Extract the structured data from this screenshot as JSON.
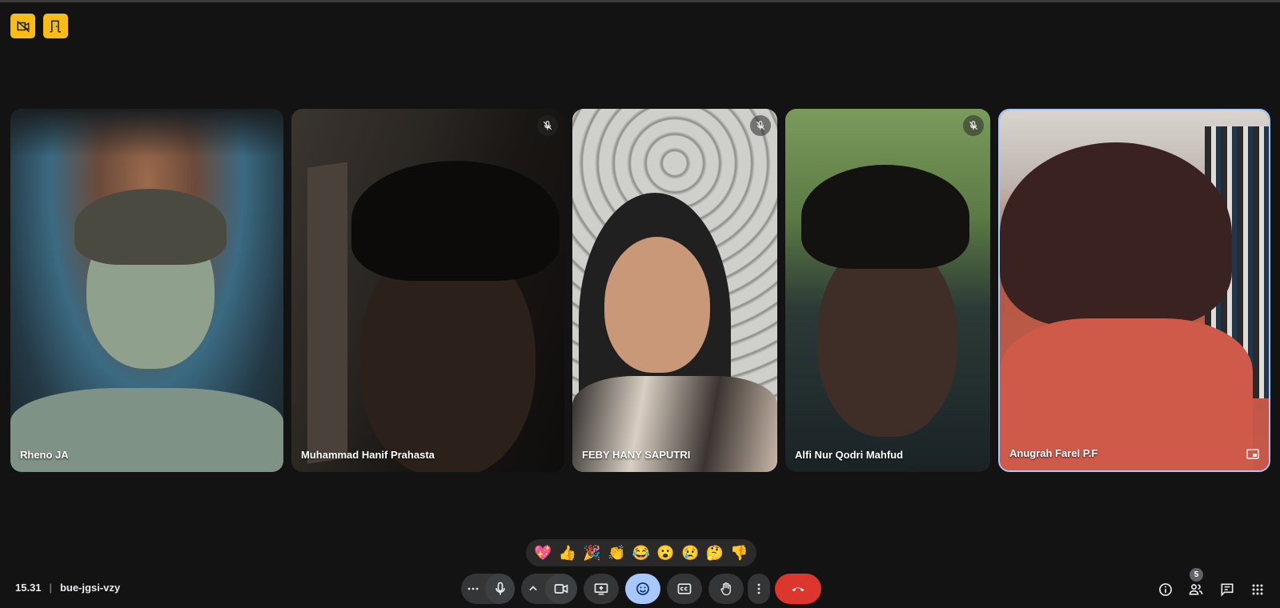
{
  "top_badges": [
    {
      "icon": "camera-off-icon"
    },
    {
      "icon": "door-exit-icon"
    }
  ],
  "participants": [
    {
      "name": "Rheno JA",
      "muted": false,
      "active": false
    },
    {
      "name": "Muhammad Hanif Prahasta",
      "muted": true,
      "active": false
    },
    {
      "name": "FEBY HANY SAPUTRI",
      "muted": true,
      "active": false
    },
    {
      "name": "Alfi Nur Qodri Mahfud",
      "muted": true,
      "active": false
    },
    {
      "name": "Anugrah Farel P.F",
      "muted": false,
      "active": true
    }
  ],
  "reactions": [
    "💖",
    "👍",
    "🎉",
    "👏",
    "😂",
    "😮",
    "😢",
    "🤔",
    "👎"
  ],
  "meeting": {
    "time": "15.31",
    "separator": "|",
    "code": "bue-jgsi-vzy"
  },
  "controls": [
    {
      "icon": "more-options-icon"
    },
    {
      "icon": "microphone-icon"
    },
    {
      "icon": "chevron-up-icon"
    },
    {
      "icon": "camera-icon"
    },
    {
      "icon": "present-screen-icon"
    },
    {
      "icon": "emoji-icon"
    },
    {
      "icon": "captions-icon"
    },
    {
      "icon": "raise-hand-icon"
    },
    {
      "icon": "more-vert-icon"
    },
    {
      "icon": "end-call-icon"
    }
  ],
  "right_panel": {
    "people_count": "5"
  },
  "colors": {
    "background": "#131314",
    "accent": "#a8c7fa",
    "end_call": "#dc362e",
    "badge": "#f9bc16"
  }
}
